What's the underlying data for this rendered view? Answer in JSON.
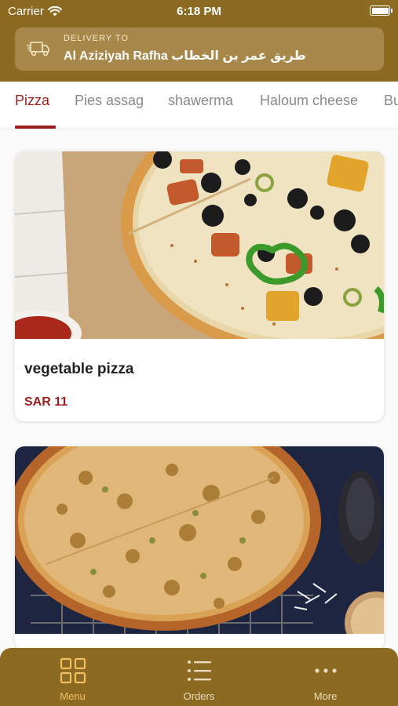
{
  "status_bar": {
    "carrier": "Carrier",
    "time": "6:18 PM"
  },
  "delivery": {
    "label": "DELIVERY TO",
    "address": "Al Aziziyah Rafha طريق عمر بن الخطاب"
  },
  "categories": {
    "tabs": [
      {
        "label": "Pizza",
        "active": true
      },
      {
        "label": "Pies assag"
      },
      {
        "label": "shawerma"
      },
      {
        "label": "Haloum cheese"
      },
      {
        "label": "Bu"
      }
    ]
  },
  "products": [
    {
      "name": "vegetable pizza",
      "price": "SAR 11"
    },
    {
      "name": "",
      "price": ""
    }
  ],
  "tabbar": {
    "items": [
      {
        "label": "Menu",
        "icon": "grid-icon",
        "active": true
      },
      {
        "label": "Orders",
        "icon": "list-icon"
      },
      {
        "label": "More",
        "icon": "more-dots-icon"
      }
    ]
  },
  "colors": {
    "brand": "#8c6a22",
    "accent": "#9c1c1c",
    "active_tab_icon": "#f0c060"
  }
}
